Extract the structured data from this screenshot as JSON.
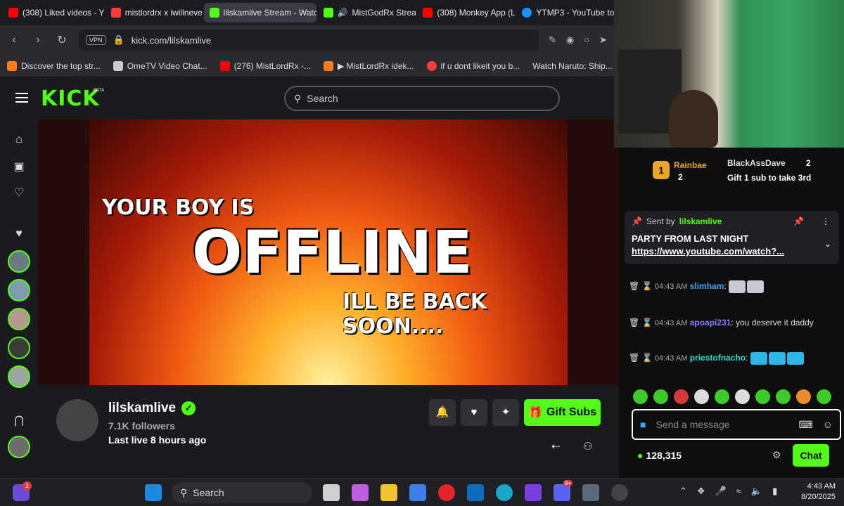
{
  "browser": {
    "tabs": [
      {
        "label": "(308) Liked videos - Y",
        "color": "#ff0000",
        "active": false
      },
      {
        "label": "mistlordrx x iwillneve",
        "color": "#ff3b3b",
        "active": false
      },
      {
        "label": "lilskamlive Stream - Watc",
        "color": "#53fc18",
        "active": true
      },
      {
        "label": "MistGodRx Strea",
        "color": "#53fc18",
        "active": false
      },
      {
        "label": "(308) Monkey App (L",
        "color": "#ff0000",
        "active": false
      },
      {
        "label": "YTMP3 - YouTube to",
        "color": "#1e90ff",
        "active": false
      }
    ],
    "vpn_badge": "VPN",
    "url": "kick.com/lilskamlive",
    "bookmarks": [
      {
        "label": "Discover the top str...",
        "color": "#ff7b1a"
      },
      {
        "label": "OmeTV Video Chat...",
        "color": "#cccccc"
      },
      {
        "label": "(276) MistLordRx -...",
        "color": "#ff0000"
      },
      {
        "label": "▶ MistLordRx idek...",
        "color": "#ff7b1a"
      },
      {
        "label": "if u dont likeit you b...",
        "color": "#ff3b3b"
      },
      {
        "label": "Watch Naruto: Ship...",
        "color": "#1b9cfc"
      }
    ]
  },
  "kick": {
    "logo": "KICK",
    "beta": "BETA",
    "search_placeholder": "Search",
    "offline_line1": "YOUR BOY IS",
    "offline_line2": "OFFLINE",
    "offline_line3": "ILL BE BACK SOON....",
    "channel_name": "lilskamlive",
    "followers": "7.1K followers",
    "last_live": "Last live 8 hours ago",
    "gift_label": "Gift Subs",
    "brand_color": "#53fc18"
  },
  "chat": {
    "leaderboard": {
      "first_rank": "1",
      "first_name": "Rainbae",
      "first_count": "2",
      "second_name": "BlackAssDave",
      "second_count": "2",
      "third_text": "Gift 1 sub to take 3rd"
    },
    "pinned": {
      "sent_by_label": "Sent by",
      "sender": "lilskamlive",
      "title": "PARTY FROM LAST NIGHT",
      "link": "https://www.youtube.com/watch?..."
    },
    "messages": [
      {
        "time": "04:43 AM",
        "user": "slimham",
        "text": ":"
      },
      {
        "time": "04:43 AM",
        "user": "apoapi231",
        "text": ": you deserve it daddy"
      },
      {
        "time": "04:43 AM",
        "user": "priestofnacho",
        "text": ":"
      }
    ],
    "input_placeholder": "Send a message",
    "points": "128,315",
    "send_label": "Chat"
  },
  "taskbar": {
    "search_label": "Search",
    "time": "4:43 AM",
    "date": "8/20/2025",
    "notification_badge": "1",
    "discord_badge": "9+"
  }
}
